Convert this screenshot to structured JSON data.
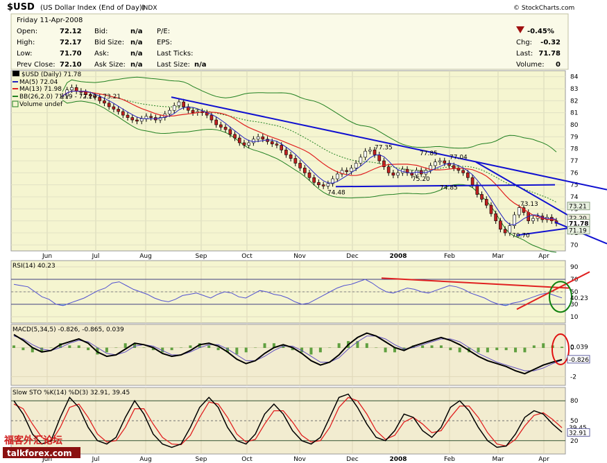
{
  "header": {
    "symbol": "$USD",
    "name": "(US Dollar Index (End of Day))",
    "exchange": "INDX",
    "copyright": "© StockCharts.com"
  },
  "quote": {
    "date": "Friday  11-Apr-2008",
    "open_label": "Open:",
    "open": "72.12",
    "high_label": "High:",
    "high": "72.17",
    "low_label": "Low:",
    "low": "71.70",
    "prev_label": "Prev Close:",
    "prev": "72.10",
    "bid_label": "Bid:",
    "bid": "n/a",
    "bidsize_label": "Bid Size:",
    "bidsize": "n/a",
    "ask_label": "Ask:",
    "ask": "n/a",
    "asksize_label": "Ask Size:",
    "asksize": "n/a",
    "pe_label": "P/E:",
    "eps_label": "EPS:",
    "lastticks_label": "Last Ticks:",
    "lastsize_label": "Last Size:",
    "lastsize": "n/a",
    "pct_change": "-0.45%",
    "chg_label": "Chg:",
    "chg": "-0.32",
    "last_label": "Last:",
    "last": "71.78",
    "volume_label": "Volume:",
    "volume": "0"
  },
  "colors": {
    "price_bg": "#f5f5d0",
    "indicator_bg": "#f5f5d0",
    "macd_bg": "#f2ecd0",
    "sto_bg": "#f2ecd0",
    "ma5": "#2020c0",
    "ma13": "#e02020",
    "bb": "#208020",
    "trend_blue": "#1010d0",
    "trend_red": "#e02020",
    "circle_green": "#108010",
    "circle_red": "#e01010",
    "rsi_line": "#5050d0",
    "rsi_fill": "#80b8d8",
    "hist": "#60a040"
  },
  "chart_data": [
    {
      "type": "candlestick",
      "panel": "price",
      "legend": [
        "$USD (Daily) 71.78",
        "MA(5) 72.04",
        "MA(13) 71.98",
        "BB(26,2.0) 71.19 - 72.20 - 73.21",
        "Volume undef"
      ],
      "x_ticks": [
        "Jun",
        "Jul",
        "Aug",
        "Sep",
        "Oct",
        "Nov",
        "Dec",
        "2008",
        "Feb",
        "Mar",
        "Apr"
      ],
      "y_ticks": [
        "84",
        "83",
        "82",
        "81",
        "80",
        "79",
        "78",
        "77",
        "76",
        "75",
        "74",
        "73",
        "72",
        "71",
        "70"
      ],
      "ylim": [
        69.5,
        84.5
      ],
      "close": [
        82.4,
        82.9,
        83.1,
        82.8,
        82.7,
        82.5,
        82.4,
        82.3,
        82.0,
        81.8,
        81.5,
        81.3,
        81.1,
        80.8,
        80.6,
        80.4,
        80.3,
        80.5,
        80.7,
        80.6,
        80.4,
        80.6,
        80.9,
        81.2,
        81.6,
        81.9,
        81.5,
        81.2,
        81.0,
        81.1,
        81.0,
        80.8,
        80.4,
        80.0,
        79.8,
        79.6,
        79.2,
        78.9,
        78.5,
        78.3,
        78.5,
        78.8,
        79.0,
        78.8,
        78.6,
        78.4,
        78.3,
        77.9,
        77.5,
        77.2,
        76.8,
        76.4,
        76.0,
        75.6,
        75.2,
        75.0,
        74.9,
        75.1,
        75.5,
        75.9,
        76.2,
        76.1,
        76.4,
        76.8,
        77.3,
        77.8,
        77.9,
        77.5,
        77.0,
        76.5,
        76.0,
        75.8,
        76.0,
        76.3,
        76.0,
        75.8,
        76.2,
        75.9,
        76.2,
        76.6,
        76.9,
        77.0,
        76.8,
        76.6,
        76.4,
        76.2,
        76.0,
        75.6,
        75.0,
        74.2,
        73.8,
        73.3,
        72.6,
        72.0,
        71.3,
        71.0,
        71.6,
        72.5,
        73.1,
        72.7,
        72.0,
        72.2,
        72.4,
        72.1,
        72.3,
        72.0,
        71.8
      ],
      "annotations": [
        "77.35",
        "77.85",
        "77.04",
        "74.48",
        "75.20",
        "74.85",
        "73.13",
        "70.70"
      ],
      "right_labels": [
        "73.21",
        "72.20",
        "71.78",
        "71.19"
      ]
    },
    {
      "type": "line",
      "panel": "rsi",
      "name": "RSI(14) 40.23",
      "y_ticks": [
        "90",
        "70",
        "50",
        "30",
        "10"
      ],
      "ylim": [
        0,
        100
      ],
      "values": [
        62,
        60,
        58,
        50,
        42,
        38,
        30,
        28,
        32,
        36,
        40,
        46,
        52,
        56,
        64,
        66,
        60,
        54,
        50,
        46,
        40,
        36,
        34,
        38,
        44,
        46,
        48,
        44,
        40,
        46,
        50,
        48,
        42,
        40,
        46,
        52,
        50,
        46,
        44,
        40,
        34,
        30,
        32,
        38,
        44,
        50,
        56,
        60,
        62,
        66,
        70,
        64,
        56,
        50,
        48,
        52,
        56,
        54,
        50,
        48,
        52,
        56,
        60,
        58,
        54,
        48,
        44,
        40,
        34,
        30,
        28,
        32,
        34,
        38,
        42,
        46,
        48,
        44,
        40.23
      ],
      "right_label": "40.23"
    },
    {
      "type": "line",
      "panel": "macd",
      "name": "MACD(5,34,5) -0.826, -0.865, 0.039",
      "y_ticks": [
        "0",
        "-2"
      ],
      "ylim": [
        -2.6,
        1.6
      ],
      "values": [
        0.9,
        0.5,
        0.0,
        -0.3,
        -0.2,
        0.2,
        0.4,
        0.6,
        0.3,
        -0.3,
        -0.6,
        -0.5,
        -0.1,
        0.3,
        0.2,
        0.0,
        -0.4,
        -0.6,
        -0.5,
        -0.2,
        0.2,
        0.3,
        0.1,
        -0.3,
        -0.8,
        -1.1,
        -0.9,
        -0.4,
        0.0,
        0.2,
        0.0,
        -0.4,
        -0.9,
        -1.2,
        -1.0,
        -0.5,
        0.2,
        0.7,
        1.0,
        0.8,
        0.4,
        0.0,
        -0.2,
        0.1,
        0.3,
        0.5,
        0.7,
        0.5,
        0.2,
        -0.2,
        -0.6,
        -0.9,
        -1.1,
        -1.3,
        -1.6,
        -1.8,
        -1.5,
        -1.2,
        -1.0,
        -0.826
      ],
      "signal": [
        0.8,
        0.6,
        0.2,
        -0.1,
        -0.2,
        0.0,
        0.3,
        0.5,
        0.4,
        0.0,
        -0.4,
        -0.5,
        -0.3,
        0.1,
        0.2,
        0.1,
        -0.2,
        -0.5,
        -0.5,
        -0.3,
        0.0,
        0.2,
        0.2,
        -0.1,
        -0.5,
        -0.9,
        -0.9,
        -0.6,
        -0.2,
        0.1,
        0.1,
        -0.2,
        -0.6,
        -1.0,
        -1.0,
        -0.7,
        -0.1,
        0.4,
        0.8,
        0.8,
        0.6,
        0.2,
        -0.1,
        0.0,
        0.2,
        0.4,
        0.6,
        0.6,
        0.4,
        0.0,
        -0.4,
        -0.7,
        -1.0,
        -1.2,
        -1.4,
        -1.6,
        -1.6,
        -1.4,
        -1.1,
        -0.865
      ],
      "right_labels": [
        "0.039",
        "-0.826"
      ]
    },
    {
      "type": "line",
      "panel": "sto",
      "name": "Slow STO %K(14) %D(3) 32.91, 39.45",
      "y_ticks": [
        "80",
        "50",
        "20"
      ],
      "ylim": [
        0,
        100
      ],
      "values": [
        80,
        60,
        30,
        15,
        20,
        55,
        85,
        70,
        40,
        20,
        15,
        25,
        55,
        80,
        60,
        30,
        15,
        10,
        15,
        40,
        70,
        85,
        70,
        40,
        20,
        15,
        30,
        60,
        75,
        60,
        35,
        20,
        15,
        25,
        55,
        85,
        90,
        70,
        45,
        25,
        20,
        35,
        60,
        55,
        35,
        25,
        40,
        70,
        80,
        65,
        40,
        20,
        10,
        12,
        30,
        55,
        65,
        60,
        45,
        32.91
      ],
      "signal": [
        75,
        68,
        45,
        25,
        18,
        40,
        70,
        75,
        55,
        30,
        18,
        20,
        40,
        68,
        68,
        45,
        25,
        15,
        14,
        28,
        55,
        78,
        75,
        55,
        30,
        18,
        22,
        45,
        65,
        65,
        48,
        28,
        18,
        20,
        40,
        70,
        85,
        80,
        60,
        35,
        22,
        28,
        48,
        55,
        45,
        32,
        35,
        55,
        72,
        72,
        55,
        32,
        15,
        12,
        22,
        42,
        58,
        62,
        52,
        39.45
      ],
      "right_labels": [
        "39.45",
        "32.91"
      ]
    }
  ],
  "watermark": {
    "cn": "福客外汇论坛",
    "url": "talkforex.com"
  }
}
